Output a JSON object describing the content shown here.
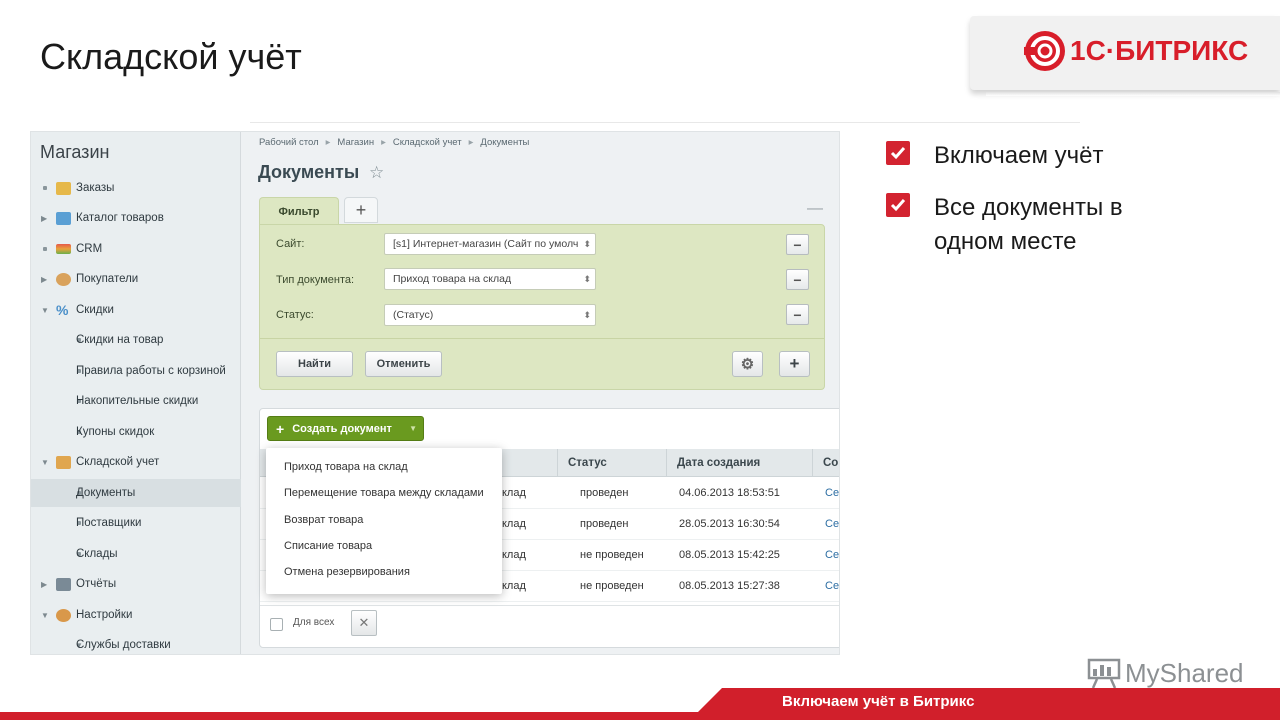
{
  "slide": {
    "title": "Складской учёт",
    "footer": "Включаем учёт в Битрикс",
    "points": [
      "Включаем учёт",
      "Все документы в",
      "одном месте"
    ],
    "watermark": "MyShared",
    "accent_color": "#d11f2b"
  },
  "logo": {
    "brand": "1С·БИТРИКС"
  },
  "sidebar": {
    "title": "Магазин",
    "items": [
      {
        "label": "Заказы",
        "icon": "orders-icon"
      },
      {
        "label": "Каталог товаров",
        "icon": "folder-icon"
      },
      {
        "label": "CRM",
        "icon": "crm-icon"
      },
      {
        "label": "Покупатели",
        "icon": "users-icon"
      },
      {
        "label": "Скидки",
        "icon": "percent-icon"
      },
      {
        "label": "Скидки на товар"
      },
      {
        "label": "Правила работы с корзиной"
      },
      {
        "label": "Накопительные скидки"
      },
      {
        "label": "Купоны скидок"
      },
      {
        "label": "Складской учет",
        "icon": "warehouse-icon"
      },
      {
        "label": "Документы",
        "active": true
      },
      {
        "label": "Поставщики"
      },
      {
        "label": "Склады"
      },
      {
        "label": "Отчёты",
        "icon": "reports-icon"
      },
      {
        "label": "Настройки",
        "icon": "settings-icon"
      },
      {
        "label": "Службы доставки"
      }
    ]
  },
  "breadcrumb": [
    "Рабочий стол",
    "Магазин",
    "Складской учет",
    "Документы"
  ],
  "page": {
    "title": "Документы"
  },
  "filter": {
    "tab_label": "Фильтр",
    "add_tab": "+",
    "fields": [
      {
        "label": "Сайт:",
        "value": "[s1] Интернет-магазин (Сайт по умолч"
      },
      {
        "label": "Тип документа:",
        "value": "Приход товара на склад"
      },
      {
        "label": "Статус:",
        "value": "(Статус)"
      }
    ],
    "find_label": "Найти",
    "cancel_label": "Отменить"
  },
  "grid": {
    "create_label": "Создать документ",
    "columns": [
      "Статус",
      "Дата создания",
      "Со"
    ],
    "rows": [
      {
        "type": "клад",
        "status": "проведен",
        "date": "04.06.2013 18:53:51",
        "author": "Сер"
      },
      {
        "type": "клад",
        "status": "проведен",
        "date": "28.05.2013 16:30:54",
        "author": "Сер"
      },
      {
        "type": "клад",
        "status": "не проведен",
        "date": "08.05.2013 15:42:25",
        "author": "Сер"
      },
      {
        "type": "клад",
        "status": "не проведен",
        "date": "08.05.2013 15:27:38",
        "author": "Сер"
      }
    ],
    "for_all_label": "Для всех"
  },
  "dropdown": {
    "items": [
      "Приход товара на склад",
      "Перемещение товара между складами",
      "Возврат товара",
      "Списание товара",
      "Отмена резервирования"
    ]
  }
}
